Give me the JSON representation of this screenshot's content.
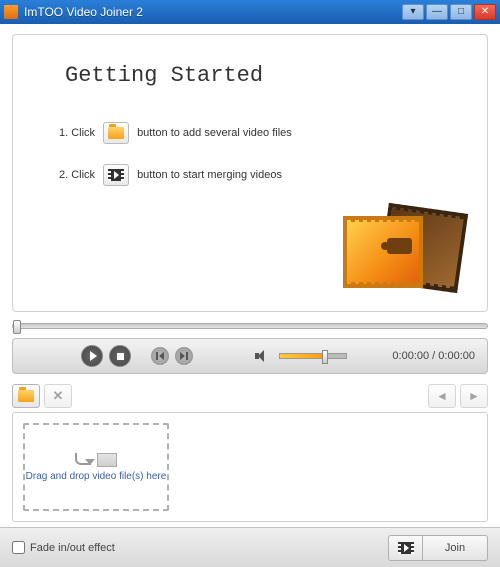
{
  "window": {
    "title": "ImTOO Video Joiner 2"
  },
  "getting_started": {
    "heading": "Getting Started",
    "step1_prefix": "1. Click",
    "step1_suffix": "button to add several video files",
    "step2_prefix": "2. Click",
    "step2_suffix": "button to start merging videos"
  },
  "player": {
    "time": "0:00:00 / 0:00:00"
  },
  "dropzone": {
    "text": "Drag and drop video file(s) here"
  },
  "bottom": {
    "fade_label": "Fade in/out effect",
    "join_label": "Join"
  }
}
